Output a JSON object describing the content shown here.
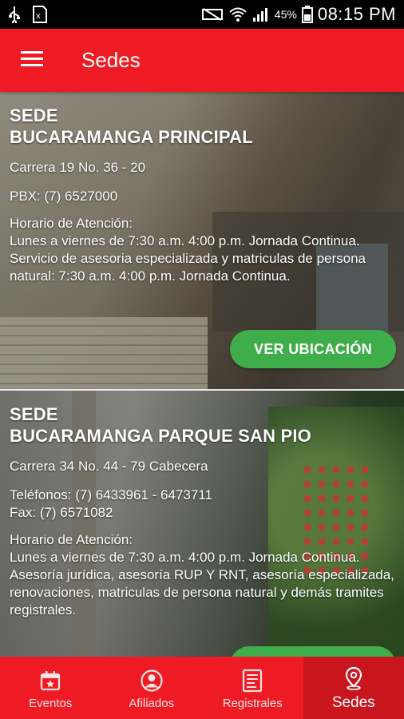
{
  "statusbar": {
    "battery_percent": "45%",
    "time": "08:15 PM"
  },
  "appbar": {
    "title": "Sedes"
  },
  "sedes": [
    {
      "title_line1": "SEDE",
      "title_line2": "BUCARAMANGA PRINCIPAL",
      "address": "Carrera 19 No. 36 - 20",
      "phones": "PBX: (7) 6527000",
      "fax": "",
      "hours_label": "Horario de Atención:",
      "hours": "Lunes a viernes de 7:30 a.m. 4:00 p.m. Jornada Continua.",
      "services": "Servicio de asesoria especializada y matriculas de persona natural: 7:30 a.m. 4:00 p.m. Jornada Continua.",
      "button": "VER UBICACIÓN"
    },
    {
      "title_line1": "SEDE",
      "title_line2": "BUCARAMANGA PARQUE SAN PIO",
      "address": "Carrera 34 No. 44 - 79 Cabecera",
      "phones": "Teléfonos: (7) 6433961 - 6473711",
      "fax": "Fax: (7) 6571082",
      "hours_label": "Horario de Atención:",
      "hours": "Lunes a viernes de 7:30 a.m. 4:00 p.m. Jornada Continua.",
      "services": "Asesoría jurídica, asesoría RUP Y RNT, asesoría especializada, renovaciones, matriculas de persona natural y demás tramites registrales.",
      "button": ""
    }
  ],
  "bottom_nav": [
    {
      "label": "Eventos",
      "icon": "calendar-star-icon",
      "active": false
    },
    {
      "label": "Afiliados",
      "icon": "user-circle-icon",
      "active": false
    },
    {
      "label": "Registrales",
      "icon": "document-icon",
      "active": false
    },
    {
      "label": "Sedes",
      "icon": "location-pin-icon",
      "active": true
    }
  ],
  "colors": {
    "primary": "#ee1b24",
    "active_tab": "#c9161e",
    "button_green": "#3fae4a"
  }
}
